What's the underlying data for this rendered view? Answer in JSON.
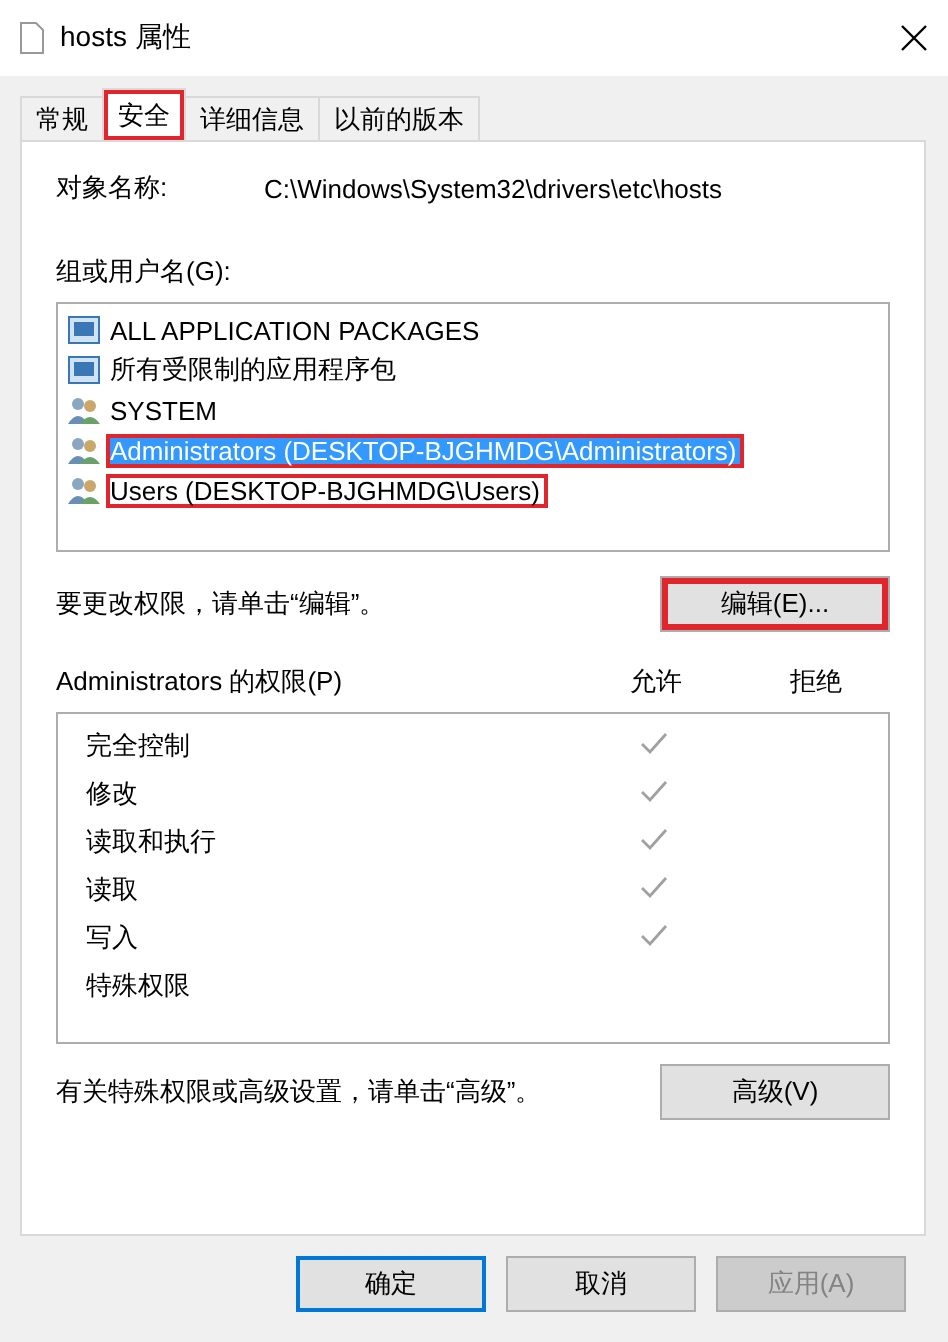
{
  "window": {
    "title": "hosts 属性"
  },
  "tabs": [
    {
      "label": "常规",
      "selected": false,
      "highlighted": false
    },
    {
      "label": "安全",
      "selected": true,
      "highlighted": true
    },
    {
      "label": "详细信息",
      "selected": false,
      "highlighted": false
    },
    {
      "label": "以前的版本",
      "selected": false,
      "highlighted": false
    }
  ],
  "object_name": {
    "label": "对象名称:",
    "value": "C:\\Windows\\System32\\drivers\\etc\\hosts"
  },
  "groups": {
    "label": "组或用户名(G):",
    "items": [
      {
        "kind": "package",
        "name": "ALL APPLICATION PACKAGES",
        "selected": false,
        "highlighted": false
      },
      {
        "kind": "package",
        "name": "所有受限制的应用程序包",
        "selected": false,
        "highlighted": false
      },
      {
        "kind": "group",
        "name": "SYSTEM",
        "selected": false,
        "highlighted": false
      },
      {
        "kind": "group",
        "name": "Administrators (DESKTOP-BJGHMDG\\Administrators)",
        "selected": true,
        "highlighted": true
      },
      {
        "kind": "group",
        "name": "Users (DESKTOP-BJGHMDG\\Users)",
        "selected": false,
        "highlighted": true
      }
    ]
  },
  "edit_hint": "要更改权限，请单击“编辑”。",
  "edit_button": {
    "label": "编辑(E)...",
    "highlighted": true
  },
  "permissions": {
    "label": "Administrators 的权限(P)",
    "allow_header": "允许",
    "deny_header": "拒绝",
    "rows": [
      {
        "name": "完全控制",
        "allow": true,
        "deny": false
      },
      {
        "name": "修改",
        "allow": true,
        "deny": false
      },
      {
        "name": "读取和执行",
        "allow": true,
        "deny": false
      },
      {
        "name": "读取",
        "allow": true,
        "deny": false
      },
      {
        "name": "写入",
        "allow": true,
        "deny": false
      },
      {
        "name": "特殊权限",
        "allow": false,
        "deny": false
      }
    ]
  },
  "advanced_hint": "有关特殊权限或高级设置，请单击“高级”。",
  "advanced_button": "高级(V)",
  "buttons": [
    {
      "label": "确定",
      "kind": "default",
      "disabled": false
    },
    {
      "label": "取消",
      "kind": "normal",
      "disabled": false
    },
    {
      "label": "应用(A)",
      "kind": "normal",
      "disabled": true
    }
  ]
}
